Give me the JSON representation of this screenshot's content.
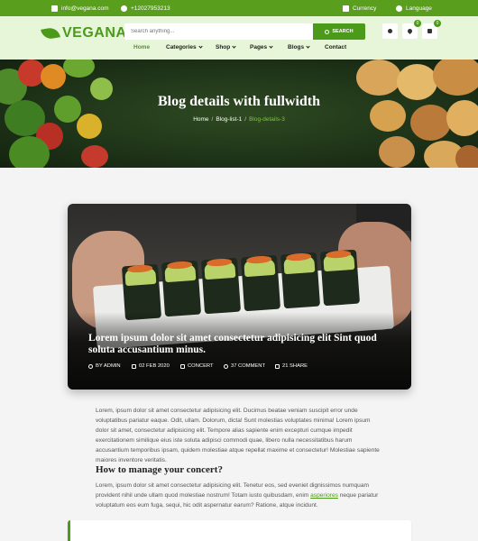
{
  "topbar": {
    "email": "info@vegana.com",
    "phone": "+12027953213",
    "currency": "Currency",
    "language": "Language"
  },
  "header": {
    "logo": "VEGANA",
    "search_placeholder": "Search anything...",
    "search_button": "SEARCH",
    "wishlist_count": "0",
    "cart_count": "0"
  },
  "nav": {
    "items": [
      "Home",
      "Categories",
      "Shop",
      "Pages",
      "Blogs",
      "Contact"
    ]
  },
  "hero": {
    "title": "Blog details with fullwidth",
    "breadcrumb": [
      "Home",
      "Blog-list-1",
      "Blog-details-3"
    ]
  },
  "post": {
    "title": "Lorem ipsum dolor sit amet consectetur adipisicing elit Sint quod soluta accusantium minus.",
    "author": "BY ADMIN",
    "date": "02 FEB 2020",
    "category": "CONCERT",
    "comments": "37 COMMENT",
    "shares": "21 SHARE"
  },
  "article": {
    "paragraph1": "Lorem, ipsum dolor sit amet consectetur adipisicing elit. Ducimus beatae veniam suscipit error unde voluptatibus pariatur eaque. Odit, ullam. Dolorum, dicta! Sunt molestias voluptates minima! Lorem ipsum dolor sit amet, consectetur adipisicing elit. Tempore alias sapiente enim excepturi cumque impedit exercitationem similique eius iste soluta adipisci commodi quae, libero nulla necessitatibus harum accusantium temporibus ipsam, quidem molestiae atque repellat maxime et consectetur! Molestiae sapiente maiores inventore veritatis.",
    "heading": "How to manage your concert?",
    "paragraph2_before": "Lorem, ipsum dolor sit amet consectetur adipisicing elit. Tenetur eos, sed eveniet dignissimos numquam provident nihil unde ullam quod molestiae nostrum! Totam iusto quibusdam, enim ",
    "paragraph2_link": "asperiores",
    "paragraph2_after": " neque pariatur voluptatum eos eum fuga, sequi, hic odit aspernatur earum? Ratione, atque incidunt."
  },
  "colors": {
    "brand": "#4c9a1a",
    "topbar": "#5a9e1e",
    "header_bg": "#e7f6d8"
  }
}
